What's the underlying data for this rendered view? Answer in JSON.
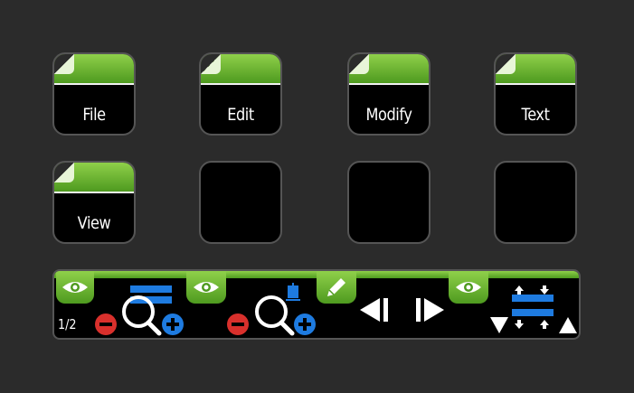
{
  "keys": [
    {
      "label": "File",
      "active": true
    },
    {
      "label": "Edit",
      "active": true
    },
    {
      "label": "Modify",
      "active": true
    },
    {
      "label": "Text",
      "active": true
    },
    {
      "label": "View",
      "active": true
    },
    {
      "label": "",
      "active": false
    },
    {
      "label": "",
      "active": false
    },
    {
      "label": "",
      "active": false
    }
  ],
  "touch_strip": {
    "page_indicator": "1/2",
    "segments": [
      {
        "tab_icon": "eye-icon",
        "icon": "zoom-horizontal-icon"
      },
      {
        "tab_icon": "eye-icon",
        "icon": "zoom-vertical-icon"
      },
      {
        "tab_icon": "pencil-icon",
        "icon": "frame-step-icon"
      },
      {
        "tab_icon": "eye-icon",
        "icon": "track-height-icon"
      }
    ]
  },
  "colors": {
    "background": "#2b2b2b",
    "accent_green": "#6cb52e",
    "zoom_in_blue": "#1e7be0",
    "zoom_out_red": "#d9302c"
  }
}
